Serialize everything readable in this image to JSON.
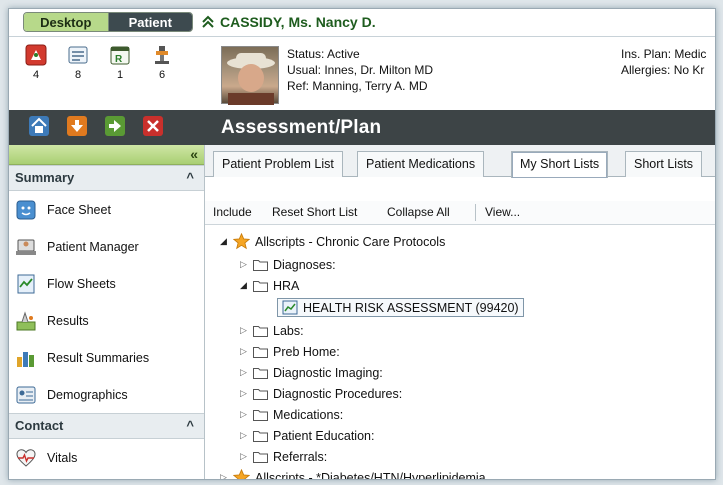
{
  "topbar": {
    "desktop_label": "Desktop",
    "patient_label": "Patient",
    "patient_name": "CASSIDY, Ms. Nancy D."
  },
  "counters": [
    {
      "icon": "alerts-icon",
      "value": "4"
    },
    {
      "icon": "notes-icon",
      "value": "8"
    },
    {
      "icon": "rx-icon",
      "value": "1"
    },
    {
      "icon": "pin-icon",
      "value": "6"
    }
  ],
  "patient_info": {
    "status": "Status: Active",
    "usual": "Usual: Innes, Dr. Milton MD",
    "ref": "Ref: Manning, Terry A. MD",
    "ins_plan": "Ins. Plan: Medic",
    "allergies": "Allergies: No Kr"
  },
  "section_title": "Assessment/Plan",
  "sidebar": {
    "collapse_glyph": "«",
    "summary_header": "Summary",
    "items": [
      {
        "label": "Face Sheet",
        "icon": "face-sheet-icon"
      },
      {
        "label": "Patient Manager",
        "icon": "patient-manager-icon"
      },
      {
        "label": "Flow Sheets",
        "icon": "flow-sheets-icon"
      },
      {
        "label": "Results",
        "icon": "results-icon"
      },
      {
        "label": "Result Summaries",
        "icon": "result-summaries-icon"
      },
      {
        "label": "Demographics",
        "icon": "demographics-icon"
      }
    ],
    "contact_header": "Contact",
    "contact_items": [
      {
        "label": "Vitals",
        "icon": "vitals-icon"
      }
    ]
  },
  "tabs": [
    {
      "label": "Patient Problem List"
    },
    {
      "label": "Patient Medications"
    },
    {
      "label": "My Short Lists"
    },
    {
      "label": "Short Lists"
    }
  ],
  "toolbar": {
    "include": "Include",
    "reset": "Reset Short List",
    "collapse": "Collapse All",
    "view": "View..."
  },
  "tree": {
    "root1": "Allscripts - Chronic Care Protocols",
    "diagnoses": "Diagnoses:",
    "hra": "HRA",
    "hra_item": "HEALTH RISK ASSESSMENT (99420)",
    "labs": "Labs:",
    "preb": "Preb Home:",
    "imaging": "Diagnostic Imaging:",
    "procedures": "Diagnostic Procedures:",
    "medications": "Medications:",
    "education": "Patient Education:",
    "referrals": "Referrals:",
    "root2": "Allscripts - *Diabetes/HTN/Hyperlipidemia"
  },
  "colors": {
    "accent_green": "#b7d98a",
    "dark_band": "#3d4446",
    "name_green": "#1e5c1e"
  }
}
